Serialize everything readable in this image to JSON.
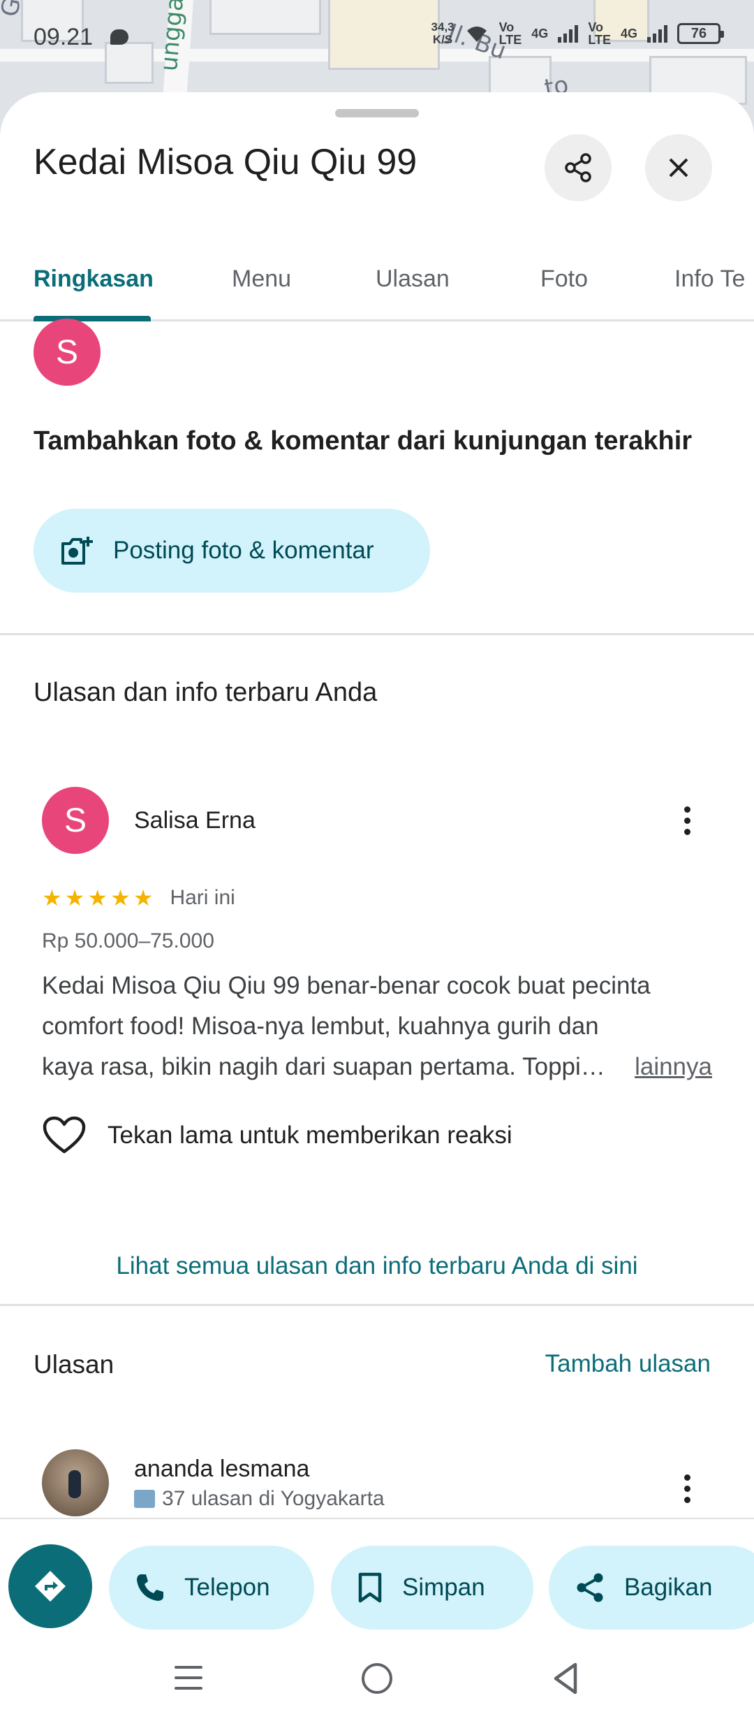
{
  "status_bar": {
    "time": "09.21",
    "speed_value": "34,3",
    "speed_unit": "K/S",
    "volte1": "Vo\nLTE",
    "net1": "4G",
    "volte2": "Vo\nLTE",
    "net2": "4G",
    "battery": "76"
  },
  "map": {
    "labels": [
      "Gg. Ca",
      "unggal",
      "Jl. Bu",
      "to"
    ]
  },
  "place": {
    "title": "Kedai Misoa Qiu Qiu 99"
  },
  "tabs": [
    {
      "label": "Ringkasan",
      "active": true
    },
    {
      "label": "Menu",
      "active": false
    },
    {
      "label": "Ulasan",
      "active": false
    },
    {
      "label": "Foto",
      "active": false
    },
    {
      "label": "Info Te",
      "active": false
    }
  ],
  "user": {
    "initial": "S"
  },
  "add_photo": {
    "prompt": "Tambahkan foto & komentar dari kunjungan terakhir",
    "button_label": "Posting foto & komentar"
  },
  "your_reviews": {
    "title": "Ulasan dan info terbaru Anda",
    "reviewer_initial": "S",
    "reviewer_name": "Salisa Erna",
    "rating": 5,
    "when": "Hari ini",
    "price": "Rp 50.000–75.000",
    "text_lines": [
      "Kedai Misoa Qiu Qiu 99 benar-benar cocok buat pecinta",
      "comfort food! Misoa-nya lembut, kuahnya gurih dan",
      "kaya rasa, bikin nagih dari suapan pertama. Toppi…"
    ],
    "more_label": "lainnya",
    "react_label": "Tekan lama untuk memberikan reaksi",
    "see_all_label": "Lihat semua ulasan dan info terbaru Anda di sini"
  },
  "reviews": {
    "title": "Ulasan",
    "add_label": "Tambah ulasan",
    "first": {
      "name": "ananda lesmana",
      "meta": "37 ulasan di Yogyakarta"
    }
  },
  "actions": {
    "phone": "Telepon",
    "save": "Simpan",
    "share": "Bagikan"
  },
  "colors": {
    "accent": "#0b6d78",
    "pill_bg": "#d2f3fb",
    "avatar": "#e8457a",
    "star": "#f5b301"
  }
}
